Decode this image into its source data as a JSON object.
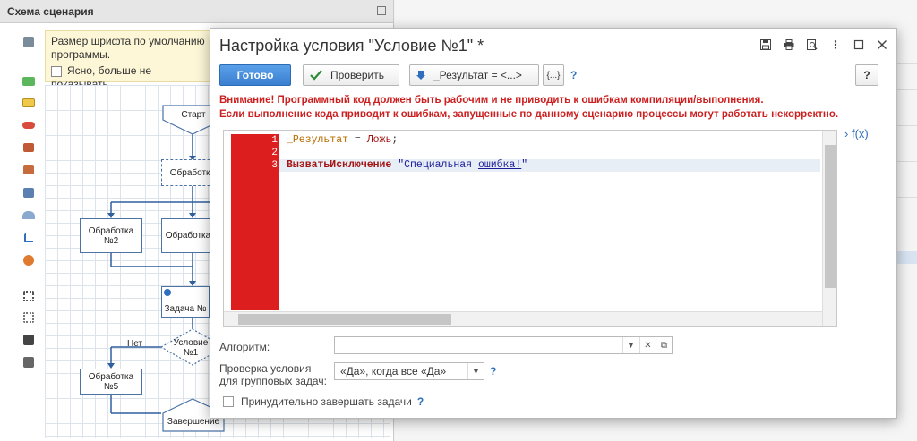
{
  "background": {
    "panel_title": "Схема сценария",
    "notice_text_line1": "Размер шрифта по умолчанию",
    "notice_text_line2": "программы.",
    "notice_checkbox_label": "Ясно, больше не показывать",
    "nodes": {
      "start": "Старт",
      "processing": "Обработка",
      "processing2": "Обработка №2",
      "processing3": "Обработка",
      "task": "Задача №",
      "condition": "Условие №1",
      "no_label": "Нет",
      "processing5": "Обработка №5",
      "end": "Завершение"
    }
  },
  "dialog": {
    "title": "Настройка условия \"Условие №1\" *",
    "toolbar": {
      "ready_label": "Готово",
      "check_label": "Проверить",
      "result_dropdown_label": "_Результат = <...>",
      "braces_label": "{...}",
      "help_label": "?",
      "right_help_label": "?"
    },
    "warning_line1": "Внимание! Программный код должен быть рабочим и не приводить к ошибкам компиляции/выполнения.",
    "warning_line2": "Если выполнение кода приводит к ошибкам, запущенные по данному сценарию процессы могут работать некорректно.",
    "code": {
      "line_numbers": [
        "1",
        "2",
        "3"
      ],
      "line1_var": "_Результат",
      "line1_op": " = ",
      "line1_val": "Ложь",
      "line1_end": ";",
      "line3_call": "ВызватьИсключение",
      "line3_str_a": " \"Специальная ",
      "line3_str_b": "ошибка!",
      "line3_str_c": "\""
    },
    "fx_label": "f(x)",
    "algorithm_label": "Алгоритм:",
    "algorithm_value": "",
    "group_check_label_line1": "Проверка условия",
    "group_check_label_line2": "для групповых задач:",
    "group_check_value": "«Да», когда все «Да»",
    "force_finish_label": "Принудительно завершать задачи",
    "help": "?"
  }
}
